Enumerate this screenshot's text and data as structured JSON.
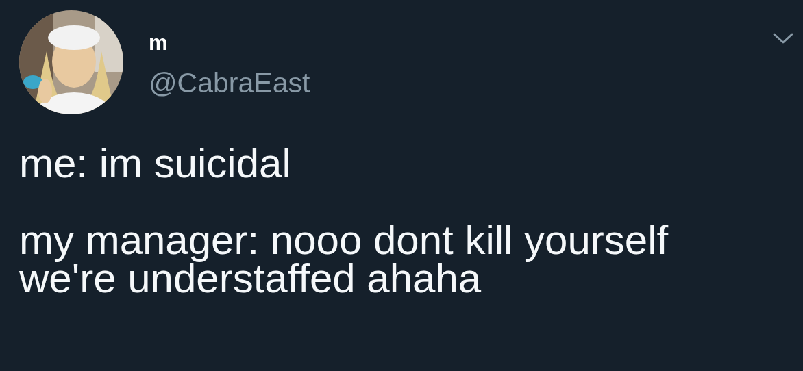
{
  "author": {
    "name": "m",
    "handle": "@CabraEast"
  },
  "tweet": {
    "text": "me: im suicidal\n\nmy manager: nooo dont kill yourself we're understaffed ahaha"
  }
}
